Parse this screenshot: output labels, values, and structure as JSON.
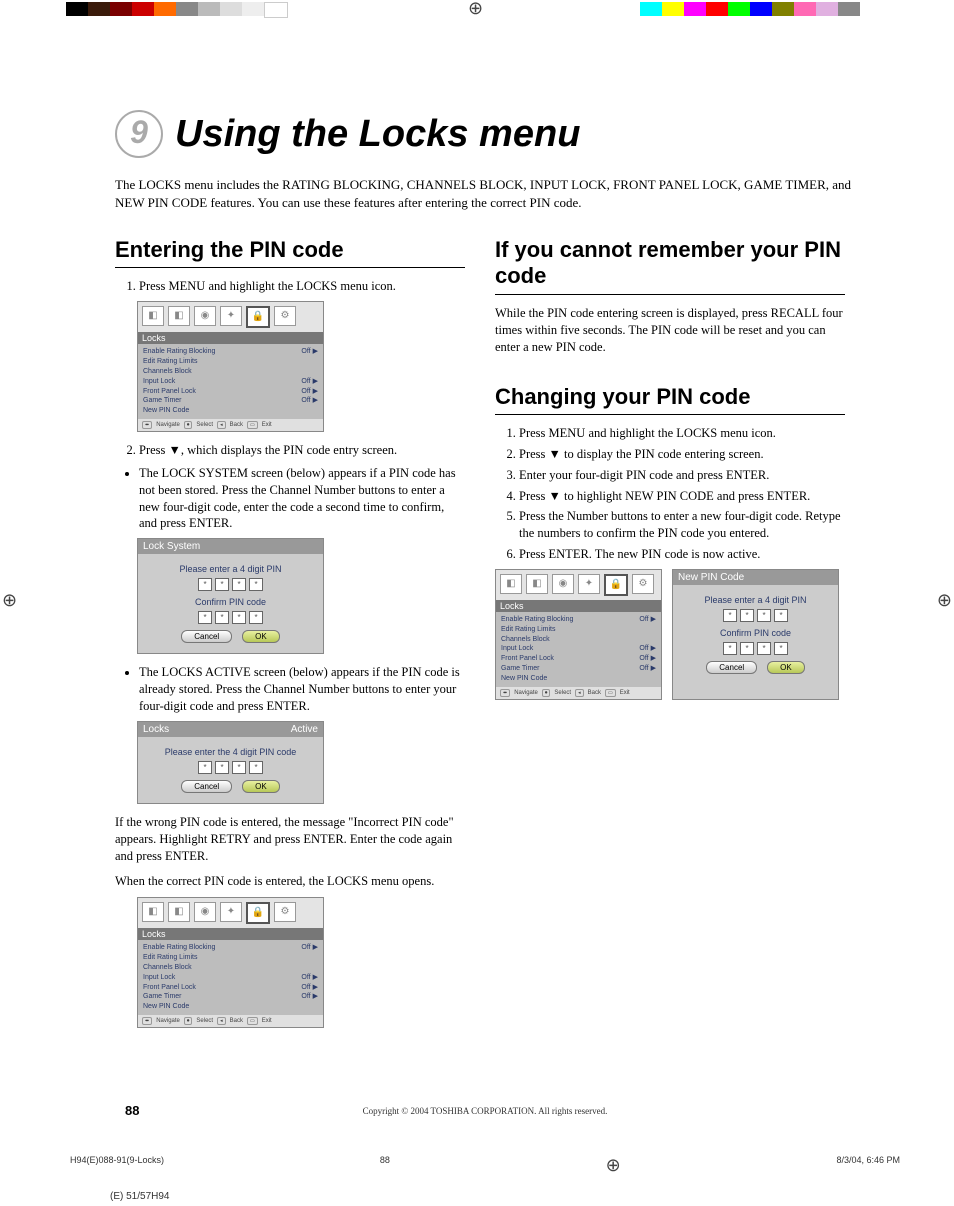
{
  "chapter": {
    "number": "9",
    "title": "Using the Locks menu"
  },
  "intro": "The LOCKS menu includes the RATING BLOCKING, CHANNELS BLOCK, INPUT LOCK, FRONT PANEL LOCK, GAME TIMER, and NEW PIN CODE features. You can use these features after entering the correct PIN code.",
  "sections": {
    "entering": {
      "heading": "Entering the PIN code",
      "step1": "Press MENU and highlight the LOCKS menu icon.",
      "step2": "Press ▼, which displays the PIN code entry screen.",
      "bullet1": "The LOCK SYSTEM screen (below) appears if a PIN code has not been stored. Press the Channel Number buttons to enter a new four-digit code, enter the code a second time to confirm, and press ENTER.",
      "bullet2": "The LOCKS ACTIVE screen (below) appears if the PIN code is already stored. Press the Channel Number buttons to enter your four-digit code and press ENTER.",
      "wrong": "If the wrong PIN code is entered, the message \"Incorrect PIN code\" appears. Highlight RETRY and press ENTER. Enter the code again and press ENTER.",
      "correct": "When the correct PIN code is entered, the LOCKS menu opens."
    },
    "forgot": {
      "heading": "If you cannot remember your PIN code",
      "body": "While the PIN code entering screen is displayed, press RECALL four times within five seconds. The PIN code will be reset and you can enter a new PIN code."
    },
    "changing": {
      "heading": "Changing your PIN code",
      "steps": [
        "Press MENU and highlight the LOCKS menu icon.",
        "Press ▼ to display the PIN code entering screen.",
        "Enter your four-digit PIN code and press ENTER.",
        "Press ▼ to highlight NEW PIN CODE and press ENTER.",
        "Press the Number buttons to enter a new four-digit code. Retype the numbers to confirm the PIN code you entered.",
        "Press ENTER. The new PIN code is now active."
      ]
    }
  },
  "osd": {
    "locks_menu": {
      "title": "Locks",
      "items": [
        {
          "label": "Enable Rating Blocking",
          "value": "Off"
        },
        {
          "label": "Edit Rating Limits",
          "value": ""
        },
        {
          "label": "Channels Block",
          "value": ""
        },
        {
          "label": "Input Lock",
          "value": "Off"
        },
        {
          "label": "Front Panel Lock",
          "value": "Off"
        },
        {
          "label": "Game Timer",
          "value": "Off"
        },
        {
          "label": "New PIN Code",
          "value": ""
        }
      ],
      "footer": {
        "nav": "Navigate",
        "sel": "Select",
        "back": "Back",
        "exit": "Exit"
      }
    },
    "lock_system": {
      "title": "Lock System",
      "msg1": "Please enter a 4 digit PIN",
      "msg2": "Confirm PIN code",
      "cancel": "Cancel",
      "ok": "OK"
    },
    "locks_active": {
      "title": "Locks",
      "status": "Active",
      "msg": "Please enter the 4 digit PIN code",
      "cancel": "Cancel",
      "ok": "OK"
    },
    "new_pin": {
      "title": "New PIN Code",
      "msg1": "Please enter a 4 digit PIN",
      "msg2": "Confirm PIN code",
      "cancel": "Cancel",
      "ok": "OK"
    },
    "pin_mask": "*"
  },
  "footer": {
    "copyright": "Copyright © 2004 TOSHIBA CORPORATION. All rights reserved.",
    "page": "88",
    "file": "H94(E)088-91(9-Locks)",
    "midnum": "88",
    "date": "8/3/04, 6:46 PM",
    "model": "(E) 51/57H94"
  },
  "reg_colors_left": [
    "#000",
    "#4a2a1a",
    "#800000",
    "#ff0000",
    "#ffa500",
    "#999",
    "#bbb",
    "#ddd",
    "#eee",
    "#fff"
  ],
  "reg_colors_right": [
    "#00ffff",
    "#ffff00",
    "#ff00ff",
    "#ff0000",
    "#00ff00",
    "#0000ff",
    "#808000",
    "#ff69b4",
    "#d8b0d8",
    "#888"
  ]
}
